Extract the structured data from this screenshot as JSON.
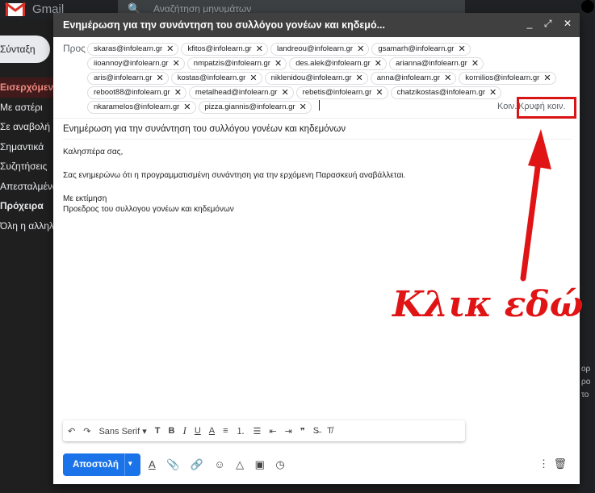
{
  "app": {
    "logo_text": "Gmail",
    "search_placeholder": "Αναζήτηση μηνυμάτων",
    "compose_button": "Σύνταξη",
    "nav": [
      "Εισερχόμενα",
      "Με αστέρι",
      "Σε αναβολή",
      "Σημαντικά",
      "Συζητήσεις",
      "Απεσταλμένα",
      "Πρόχειρα",
      "Όλη η αλληλ"
    ],
    "right_snippets": [
      "ορ",
      "ρο",
      "το"
    ]
  },
  "compose": {
    "window_title": "Ενημέρωση για την συνάντηση του συλλόγου γονέων και κηδεμό...",
    "controls": [
      "_",
      "⤢",
      "✕"
    ],
    "to_label": "Προς",
    "recipients": [
      [
        "skaras@infolearn.gr",
        "kfitos@infolearn.gr",
        "landreou@infolearn.gr",
        "gsamarh@infolearn.gr"
      ],
      [
        "iioannoy@infolearn.gr",
        "nmpatzis@infolearn.gr",
        "des.alek@infolearn.gr",
        "arianna@infolearn.gr"
      ],
      [
        "aris@infolearn.gr",
        "kostas@infolearn.gr",
        "niklenidou@infolearn.gr",
        "anna@infolearn.gr",
        "kornilios@infolearn.gr"
      ],
      [
        "reboot88@infolearn.gr",
        "metalhead@infolearn.gr",
        "rebetis@infolearn.gr",
        "chatzikostas@infolearn.gr"
      ],
      [
        "nkaramelos@infolearn.gr",
        "pizza.giannis@infolearn.gr"
      ]
    ],
    "cc_label": "Κοιν.",
    "bcc_label": "Κρυφή κοιν.",
    "subject": "Ενημέρωση για την συνάντηση του συλλόγου γονέων και κηδεμόνων",
    "body": {
      "greeting": "Καλησπέρα σας,",
      "message": "Σας ενημερώνω ότι η προγραμματισμένη συνάντηση για την ερχόμενη Παρασκευή αναβάλλεται.",
      "closing": "Με εκτίμηση",
      "signature": "Προεδρος του συλλογου γονέων και κηδεμόνων"
    },
    "toolbar": {
      "undo": "↶",
      "redo": "↷",
      "font": "Sans Serif",
      "font_dropdown": "▾",
      "size": "T",
      "bold": "B",
      "italic": "I",
      "underline": "U",
      "text_color": "A",
      "align": "≡",
      "numbered_list": "⒈",
      "bullet_list": "☰",
      "indent_less": "⇤",
      "indent_more": "⇥",
      "quote": "❞",
      "strikethrough": "S̶",
      "clear_format": "T̸"
    },
    "send_label": "Αποστολή",
    "send_dropdown": "▾",
    "bottom_icons": [
      "A",
      "📎",
      "🔗",
      "☺",
      "△",
      "▣",
      "◷"
    ],
    "more": "⋮",
    "trash": "🗑"
  },
  "annotation": {
    "text": "Κλικ εδώ",
    "color": "#e01414"
  }
}
